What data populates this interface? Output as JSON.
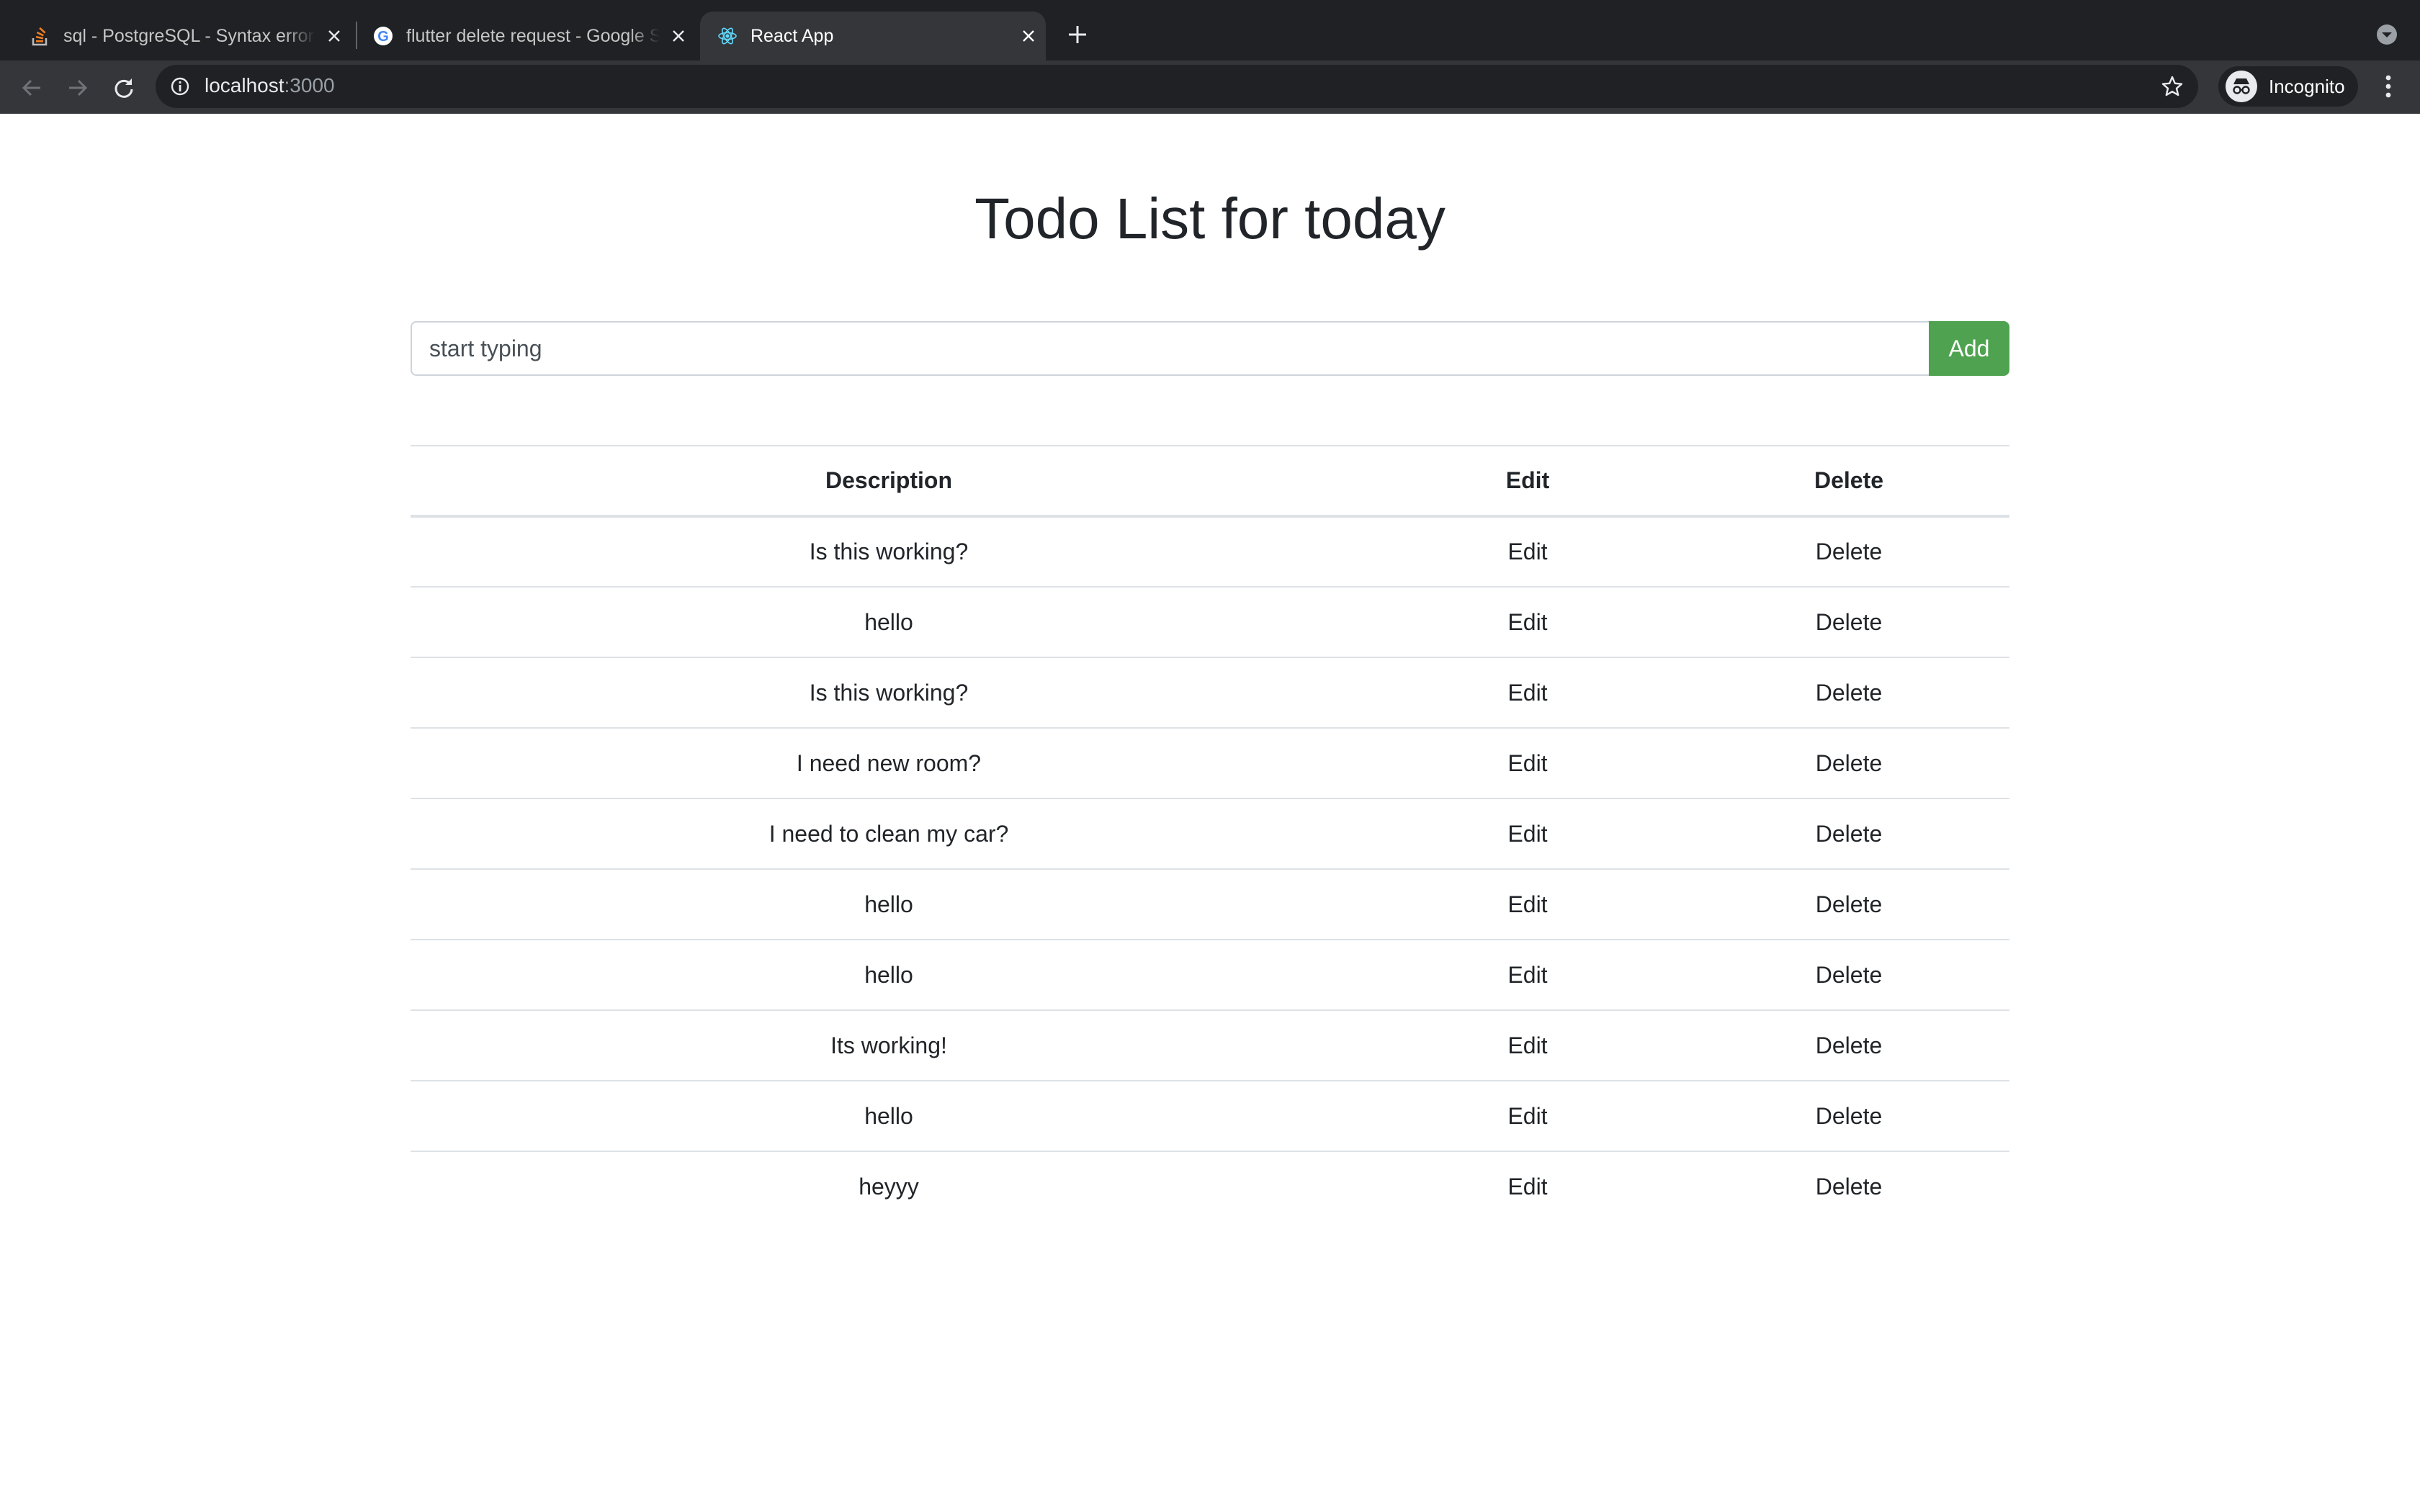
{
  "browser": {
    "tabs": [
      {
        "title": "sql - PostgreSQL - Syntax error",
        "icon": "stackoverflow-icon",
        "active": false
      },
      {
        "title": "flutter delete request - Google Search",
        "icon": "google-icon",
        "active": false
      },
      {
        "title": "React App",
        "icon": "react-icon",
        "active": true
      }
    ],
    "address": {
      "host": "localhost",
      "port": ":3000"
    },
    "profile_label": "Incognito",
    "colors": {
      "chrome_dark": "#202124",
      "chrome_toolbar": "#35363a"
    }
  },
  "page": {
    "title": "Todo List for today",
    "input_placeholder": "start typing",
    "add_label": "Add",
    "add_color": "#4fa350",
    "table": {
      "headers": [
        "Description",
        "Edit",
        "Delete"
      ],
      "rows": [
        {
          "description": "Is this working?",
          "edit": "Edit",
          "delete": "Delete"
        },
        {
          "description": "hello",
          "edit": "Edit",
          "delete": "Delete"
        },
        {
          "description": "Is this working?",
          "edit": "Edit",
          "delete": "Delete"
        },
        {
          "description": "I need new room?",
          "edit": "Edit",
          "delete": "Delete"
        },
        {
          "description": "I need to clean my car?",
          "edit": "Edit",
          "delete": "Delete"
        },
        {
          "description": "hello",
          "edit": "Edit",
          "delete": "Delete"
        },
        {
          "description": "hello",
          "edit": "Edit",
          "delete": "Delete"
        },
        {
          "description": "Its working!",
          "edit": "Edit",
          "delete": "Delete"
        },
        {
          "description": "hello",
          "edit": "Edit",
          "delete": "Delete"
        },
        {
          "description": "heyyy",
          "edit": "Edit",
          "delete": "Delete"
        }
      ]
    }
  }
}
